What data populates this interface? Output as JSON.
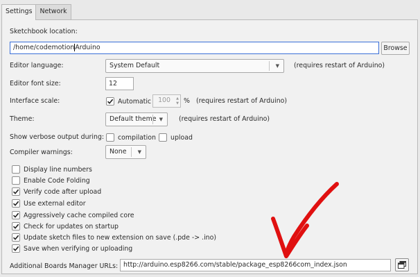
{
  "tabs": [
    {
      "label": "Settings"
    },
    {
      "label": "Network"
    }
  ],
  "sketchbook": {
    "label": "Sketchbook location:",
    "path_before_cursor": "/home/codemotion",
    "path_after_cursor": "Arduino",
    "browse_label": "Browse"
  },
  "editor_language": {
    "label": "Editor language:",
    "value": "System Default",
    "note": "(requires restart of Arduino)"
  },
  "font_size": {
    "label": "Editor font size:",
    "value": "12"
  },
  "interface_scale": {
    "label": "Interface scale:",
    "automatic_label": "Automatic",
    "automatic_checked": true,
    "value": "100",
    "unit": "%",
    "note": "(requires restart of Arduino)"
  },
  "theme": {
    "label": "Theme:",
    "value": "Default theme",
    "note": "(requires restart of Arduino)"
  },
  "verbose": {
    "label": "Show verbose output during:",
    "compilation_label": "compilation",
    "compilation_checked": false,
    "upload_label": "upload",
    "upload_checked": false
  },
  "compiler_warnings": {
    "label": "Compiler warnings:",
    "value": "None"
  },
  "options": [
    {
      "label": "Display line numbers",
      "checked": false
    },
    {
      "label": "Enable Code Folding",
      "checked": false
    },
    {
      "label": "Verify code after upload",
      "checked": true
    },
    {
      "label": "Use external editor",
      "checked": true
    },
    {
      "label": "Aggressively cache compiled core",
      "checked": true
    },
    {
      "label": "Check for updates on startup",
      "checked": true
    },
    {
      "label": "Update sketch files to new extension on save (.pde -> .ino)",
      "checked": true
    },
    {
      "label": "Save when verifying or uploading",
      "checked": true
    }
  ],
  "boards_urls": {
    "label": "Additional Boards Manager URLs:",
    "value": "http://arduino.esp8266.com/stable/package_esp8266com_index.json"
  },
  "icons": {
    "check": "check-icon",
    "dropdown": "chevron-down-icon",
    "window": "open-window-icon",
    "annotation": "red-arrow-annotation"
  },
  "colors": {
    "annotation": "#e01010",
    "accent_border": "#3a6fd8"
  }
}
